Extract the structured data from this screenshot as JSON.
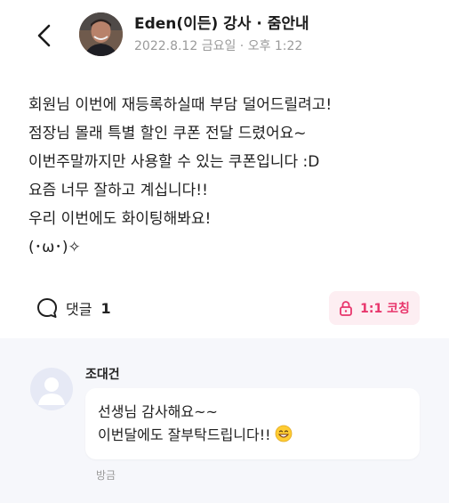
{
  "header": {
    "author_name": "Eden(이든) 강사 · 줌안내",
    "post_date": "2022.8.12 금요일 · 오후 1:22"
  },
  "post": {
    "lines": [
      "회원님 이번에 재등록하실때 부담 덜어드릴려고!",
      "점장님 몰래 특별 할인 쿠폰 전달 드렸어요~",
      "이번주말까지만 사용할 수 있는 쿠폰입니다 :D",
      "요즘 너무 잘하고 계십니다!!",
      "우리 이번에도 화이팅해봐요!",
      "(･ω･)✧"
    ]
  },
  "actions": {
    "comment_label": "댓글",
    "comment_count": "1",
    "coaching_label": "1:1 코칭"
  },
  "comment": {
    "author": "조대건",
    "lines": [
      "선생님 감사해요~~",
      "이번달에도 잘부탁드립니다!!"
    ],
    "time": "방금"
  },
  "colors": {
    "accent_pink": "#e8366c",
    "badge_bg": "#fdeef2",
    "comments_bg": "#f6f7fb",
    "muted_text": "#9a9a9a"
  },
  "icons": {
    "back": "chevron-left-icon",
    "comment": "speech-bubble-icon",
    "lock": "lock-icon",
    "default_avatar": "user-silhouette-icon",
    "emoji": "grinning-face-emoji"
  }
}
